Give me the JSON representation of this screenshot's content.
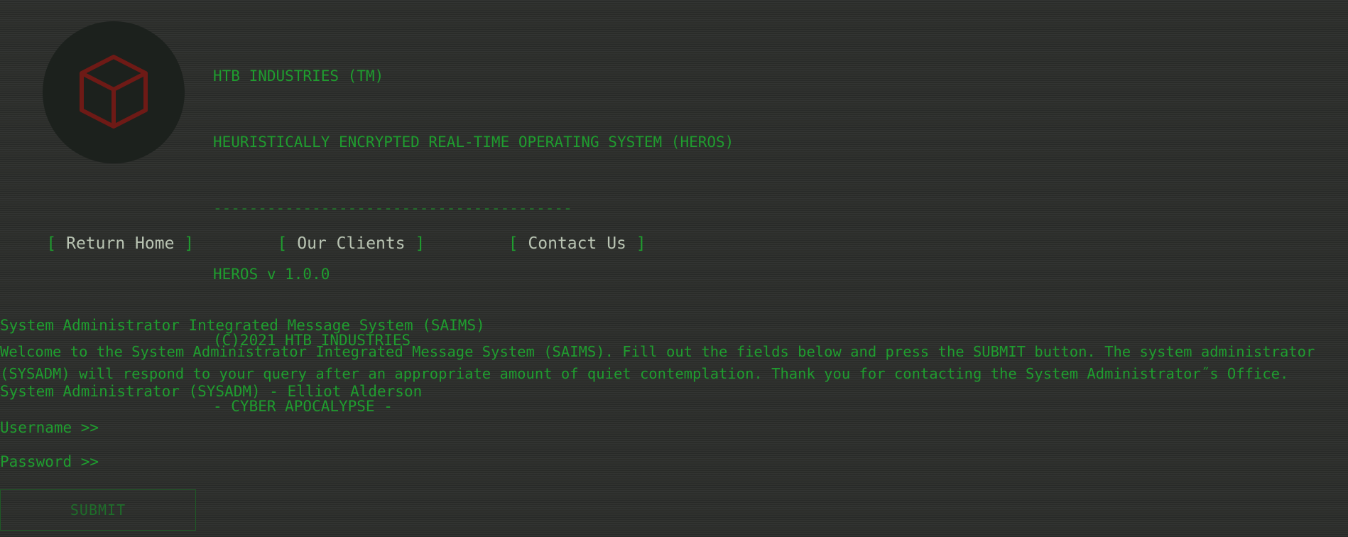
{
  "banner": {
    "line1": "HTB INDUSTRIES (TM)",
    "line2": "HEURISTICALLY ENCRYPTED REAL-TIME OPERATING SYSTEM (HEROS)",
    "divider": "----------------------------------------",
    "version": "HEROS v 1.0.0",
    "copyright": "(C)2021 HTB INDUSTRIES",
    "tagline": "- CYBER APOCALYPSE -"
  },
  "logo": {
    "icon": "cube-icon",
    "color": "#6e1a16",
    "background": "#1c211d"
  },
  "nav": {
    "open_bracket": "[",
    "close_bracket": "]",
    "items": [
      {
        "label": "Return Home"
      },
      {
        "label": "Our Clients"
      },
      {
        "label": "Contact Us"
      }
    ]
  },
  "titles": {
    "system": "System Administrator Integrated Message System (SAIMS)",
    "admin": "System Administrator (SYSADM) - Elliot Alderson"
  },
  "welcome": "Welcome to the System Administrator Integrated Message System (SAIMS). Fill out the fields below and press the SUBMIT button. The system administrator (SYSADM) will respond to your query after an appropriate amount of quiet contemplation. Thank you for contacting the System Administrator˝s Office.",
  "form": {
    "username_label": "Username >>",
    "username_value": "",
    "password_label": "Password >>",
    "password_value": "",
    "submit_label": "SUBMIT"
  },
  "colors": {
    "background": "#2b2d2a",
    "terminal_green": "#1f9d2f",
    "nav_text": "#b9c4b3"
  }
}
